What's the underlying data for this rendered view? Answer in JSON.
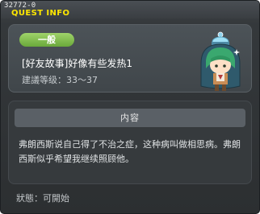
{
  "window": {
    "quest_id": "32772-0",
    "title": "QUEST INFO"
  },
  "quest": {
    "category": "一般",
    "name": "[好友故事]好像有些发热1",
    "level": "建議等级：33～37"
  },
  "detail": {
    "header": "内容",
    "description": "弗朗西斯说自己得了不治之症，这种病叫做相思病。弗朗西斯似乎希望我继续照顾他。"
  },
  "status": {
    "label": "狀態：可開始"
  }
}
